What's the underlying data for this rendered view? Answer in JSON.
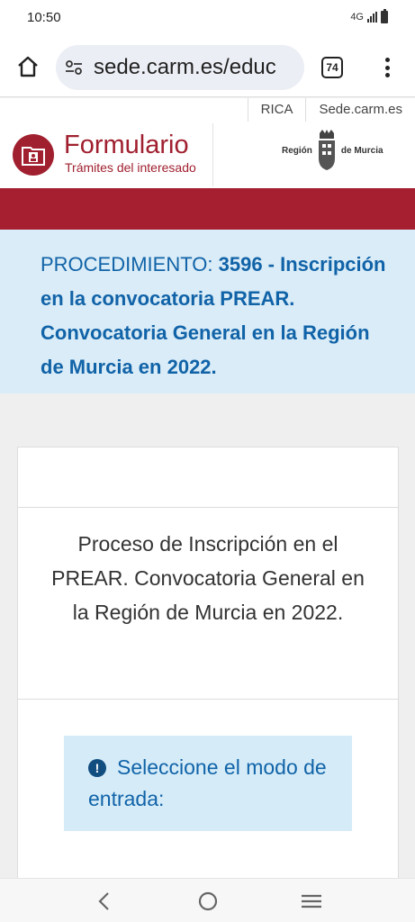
{
  "status": {
    "time": "10:50",
    "network": "4G"
  },
  "browser": {
    "url": "sede.carm.es/educ",
    "tab_count": "74"
  },
  "header": {
    "links": [
      "RICA",
      "Sede.carm.es"
    ],
    "brand_title": "Formulario",
    "brand_subtitle": "Trámites del interesado",
    "region_left": "Región",
    "region_right": "de Murcia"
  },
  "procedure": {
    "prefix": "PROCEDIMIENTO: ",
    "title": "3596 - Inscripción en la convocatoria PREAR. Convocatoria General en la Región de Murcia en 2022."
  },
  "card": {
    "description": "Proceso de Inscripción en el PREAR. Convocatoria General en la Región de Murcia en 2022.",
    "info_icon": "!",
    "info_text": "Seleccione el modo de entrada:"
  },
  "colors": {
    "brand": "#a0202f",
    "band": "#a51f30",
    "link_blue": "#1163a8",
    "banner_bg": "#d9ecf7"
  }
}
